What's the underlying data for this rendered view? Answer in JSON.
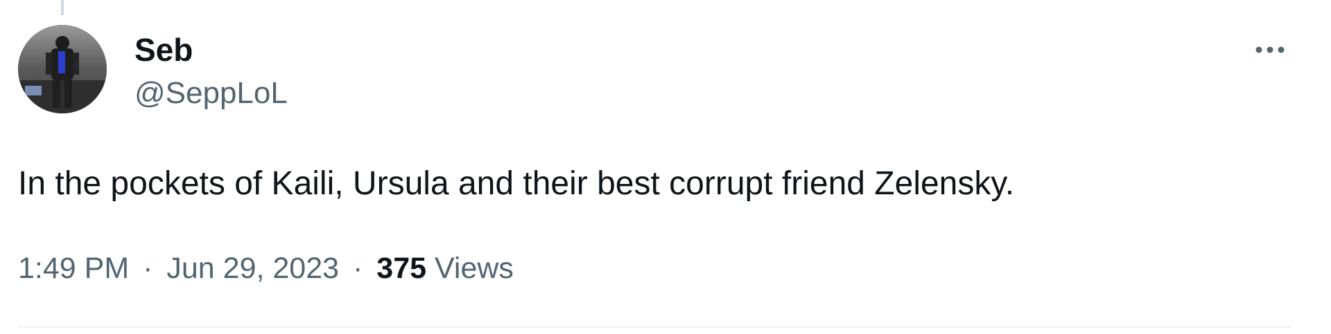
{
  "tweet": {
    "author": {
      "name": "Seb",
      "handle": "@SeppLoL"
    },
    "more_icon": "more-horizontal-icon",
    "text": "In the pockets of Kaili, Ursula and their best corrupt friend Zelensky.",
    "time": "1:49 PM",
    "separator": "·",
    "date": "Jun 29, 2023",
    "views_count": "375",
    "views_label": "Views"
  },
  "colors": {
    "primary_text": "#0f1419",
    "secondary_text": "#536471",
    "thread_line": "#cfd9de",
    "divider": "#eff3f4"
  }
}
